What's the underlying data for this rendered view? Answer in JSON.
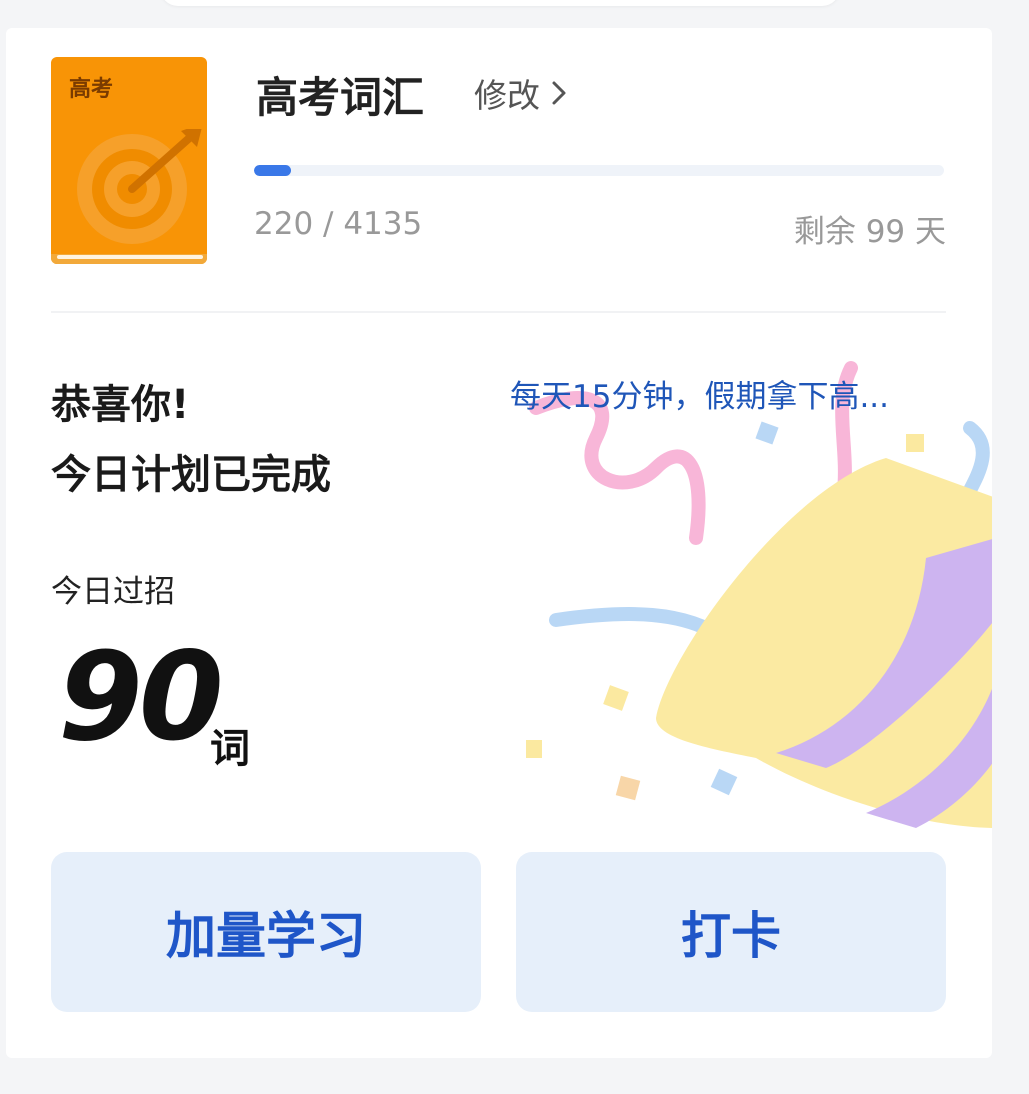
{
  "book": {
    "cover_label": "高考",
    "title": "高考词汇",
    "edit_label": "修改",
    "progress": {
      "learned": 220,
      "total": 4135,
      "text": "220 / 4135"
    },
    "days_left_text": "剩余 99 天"
  },
  "plan": {
    "congrats_line1": "恭喜你!",
    "congrats_line2": "今日计划已完成",
    "slogan": "每天15分钟，假期拿下高...",
    "today_label": "今日过招",
    "today_count": "90",
    "today_unit": "词"
  },
  "actions": {
    "extra_study_label": "加量学习",
    "checkin_label": "打卡"
  },
  "colors": {
    "accent": "#3a78e8",
    "button_bg": "#e6effa",
    "button_text": "#1f56c8",
    "book_cover": "#f89406",
    "slogan": "#1f56b8"
  },
  "icons": [
    "target-icon",
    "chevron-right-icon",
    "party-popper-icon"
  ]
}
